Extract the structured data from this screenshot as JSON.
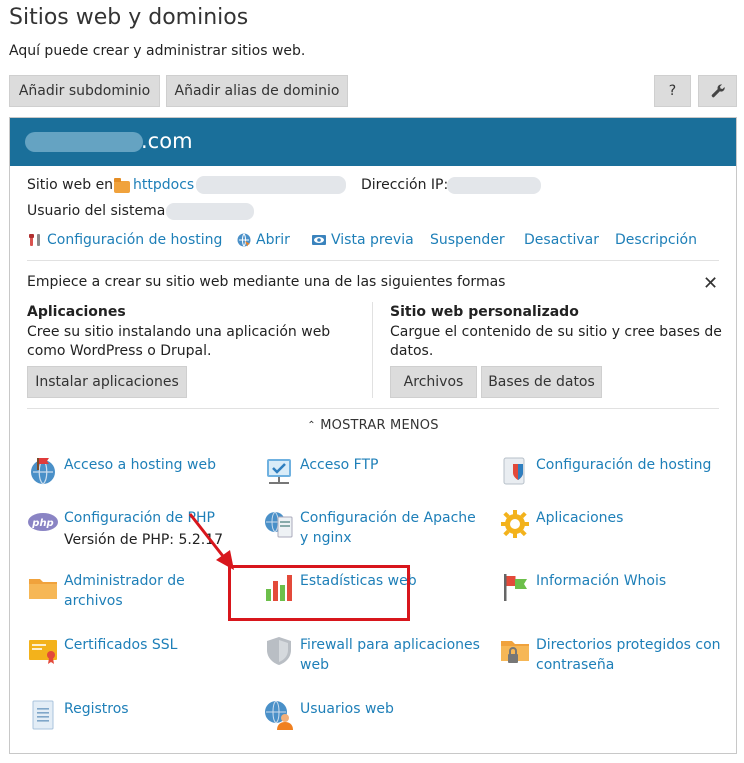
{
  "page": {
    "title": "Sitios web y dominios",
    "description": "Aquí puede crear y administrar sitios web."
  },
  "toolbar": {
    "add_subdomain": "Añadir subdominio",
    "add_domain_alias": "Añadir alias de dominio",
    "help": "?",
    "settings_icon": "wrench-icon"
  },
  "domain": {
    "suffix": ".com",
    "website_at_label": "Sitio web en",
    "website_folder": "httpdocs",
    "ip_label": "Dirección IP:",
    "system_user_label": "Usuario del sistema:",
    "quick_links": [
      {
        "label": "Configuración de hosting",
        "icon": "tools-icon"
      },
      {
        "label": "Abrir",
        "icon": "globe-open-icon"
      },
      {
        "label": "Vista previa",
        "icon": "preview-icon"
      },
      {
        "label": "Suspender"
      },
      {
        "label": "Desactivar"
      },
      {
        "label": "Descripción"
      }
    ]
  },
  "getting_started": {
    "heading": "Empiece a crear su sitio web mediante una de las siguientes formas",
    "apps": {
      "title": "Aplicaciones",
      "desc_line1": "Cree su sitio instalando una aplicación web",
      "desc_line2": "como WordPress o Drupal.",
      "button": "Instalar aplicaciones"
    },
    "custom": {
      "title": "Sitio web personalizado",
      "desc_line1": "Cargue el contenido de su sitio y cree bases de",
      "desc_line2": "datos.",
      "files_button": "Archivos",
      "db_button": "Bases de datos"
    }
  },
  "show_less": "MOSTRAR MENOS",
  "tools": [
    {
      "line1": "Acceso a hosting web",
      "line2": "",
      "sub": "",
      "icon": "hosting-access-icon"
    },
    {
      "line1": "Acceso FTP",
      "line2": "",
      "sub": "",
      "icon": "ftp-icon"
    },
    {
      "line1": "Configuración de hosting",
      "line2": "",
      "sub": "",
      "icon": "hosting-settings-icon"
    },
    {
      "line1": "Configuración de PHP",
      "line2": "",
      "sub": "Versión de PHP: 5.2.17",
      "icon": "php-icon"
    },
    {
      "line1": "Configuración de Apache",
      "line2": "y nginx",
      "sub": "",
      "icon": "apache-nginx-icon"
    },
    {
      "line1": "Aplicaciones",
      "line2": "",
      "sub": "",
      "icon": "applications-gear-icon"
    },
    {
      "line1": "Administrador de",
      "line2": "archivos",
      "sub": "",
      "icon": "file-manager-icon"
    },
    {
      "line1": "Estadísticas web",
      "line2": "",
      "sub": "",
      "icon": "statistics-icon"
    },
    {
      "line1": "Información Whois",
      "line2": "",
      "sub": "",
      "icon": "whois-flag-icon"
    },
    {
      "line1": "Certificados SSL",
      "line2": "",
      "sub": "",
      "icon": "ssl-certificate-icon"
    },
    {
      "line1": "Firewall para aplicaciones",
      "line2": "web",
      "sub": "",
      "icon": "firewall-shield-icon"
    },
    {
      "line1": "Directorios protegidos con",
      "line2": "contraseña",
      "sub": "",
      "icon": "protected-dir-icon"
    },
    {
      "line1": "Registros",
      "line2": "",
      "sub": "",
      "icon": "logs-icon"
    },
    {
      "line1": "Usuarios web",
      "line2": "",
      "sub": "",
      "icon": "web-users-icon"
    }
  ],
  "colors": {
    "header_blue": "#1a6f9a",
    "link_blue": "#1e7fb8",
    "highlight_red": "#d8161c"
  }
}
